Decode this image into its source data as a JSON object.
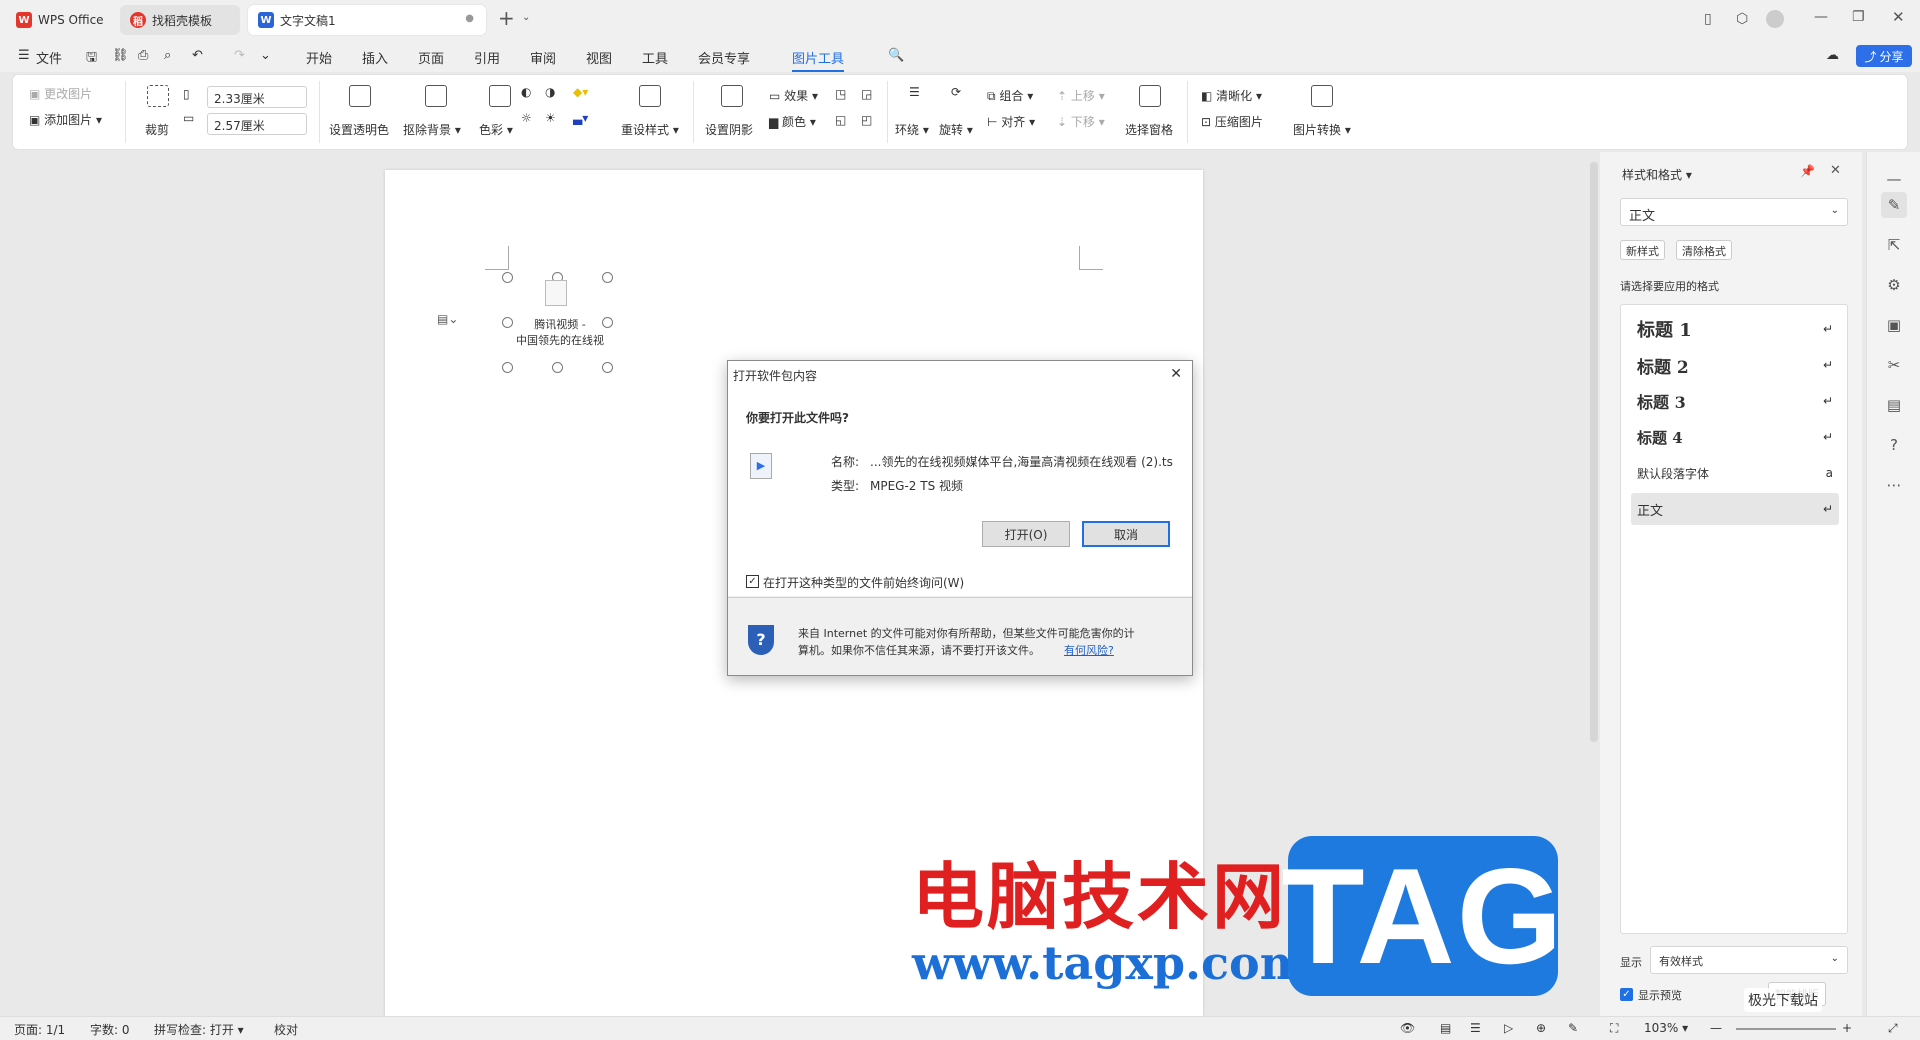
{
  "tabs": {
    "wps": "WPS Office",
    "template": "找稻壳模板",
    "doc": "文字文稿1"
  },
  "menu": {
    "file": "文件",
    "items": [
      "开始",
      "插入",
      "页面",
      "引用",
      "审阅",
      "视图",
      "工具",
      "会员专享",
      "图片工具"
    ],
    "share": "分享"
  },
  "ribbon": {
    "change_pic": "更改图片",
    "add_pic": "添加图片",
    "crop": "裁剪",
    "width": "2.33厘米",
    "height": "2.57厘米",
    "transparent": "设置透明色",
    "remove_bg": "抠除背景",
    "color": "色彩",
    "reset_style": "重设样式",
    "shadow": "设置阴影",
    "effect": "效果",
    "fill_color": "颜色",
    "wrap": "环绕",
    "rotate": "旋转",
    "group": "组合",
    "align": "对齐",
    "up": "上移",
    "down": "下移",
    "selection_pane": "选择窗格",
    "sharpen": "清晰化",
    "compress": "压缩图片",
    "convert": "图片转换"
  },
  "document": {
    "object_label_1": "腾讯视频 -",
    "object_label_2": "中国领先的在线视"
  },
  "dialog": {
    "title": "打开软件包内容",
    "question": "你要打开此文件吗?",
    "name_label": "名称:",
    "name_value": "...领先的在线视频媒体平台,海量高清视频在线观看 (2).ts",
    "type_label": "类型:",
    "type_value": "MPEG-2 TS 视频",
    "open_btn": "打开(O)",
    "cancel_btn": "取消",
    "always_ask": "在打开这种类型的文件前始终询问(W)",
    "warning_1": "来自 Internet 的文件可能对你有所帮助，但某些文件可能危害你的计",
    "warning_2": "算机。如果你不信任其来源，请不要打开该文件。",
    "risk_link": "有何风险?"
  },
  "panel": {
    "title": "样式和格式",
    "current_style": "正文",
    "new_style": "新样式",
    "clear_format": "清除格式",
    "prompt": "请选择要应用的格式",
    "styles": [
      {
        "label": "标题 1",
        "mark": "↵"
      },
      {
        "label": "标题 2",
        "mark": "↵"
      },
      {
        "label": "标题 3",
        "mark": "↵"
      },
      {
        "label": "标题 4",
        "mark": "↵"
      },
      {
        "label": "默认段落字体",
        "mark": "a"
      },
      {
        "label": "正文",
        "mark": "↵"
      }
    ],
    "show_label": "显示",
    "show_value": "有效样式",
    "preview": "显示预览",
    "smart": "智能排版"
  },
  "status": {
    "page": "页面: 1/1",
    "words": "字数: 0",
    "spell": "拼写检查: 打开",
    "proof": "校对",
    "zoom": "103%"
  },
  "watermark": {
    "text": "电脑技术网",
    "url": "www.tagxp.com",
    "tag": "TAG",
    "site": "极光下载站"
  }
}
